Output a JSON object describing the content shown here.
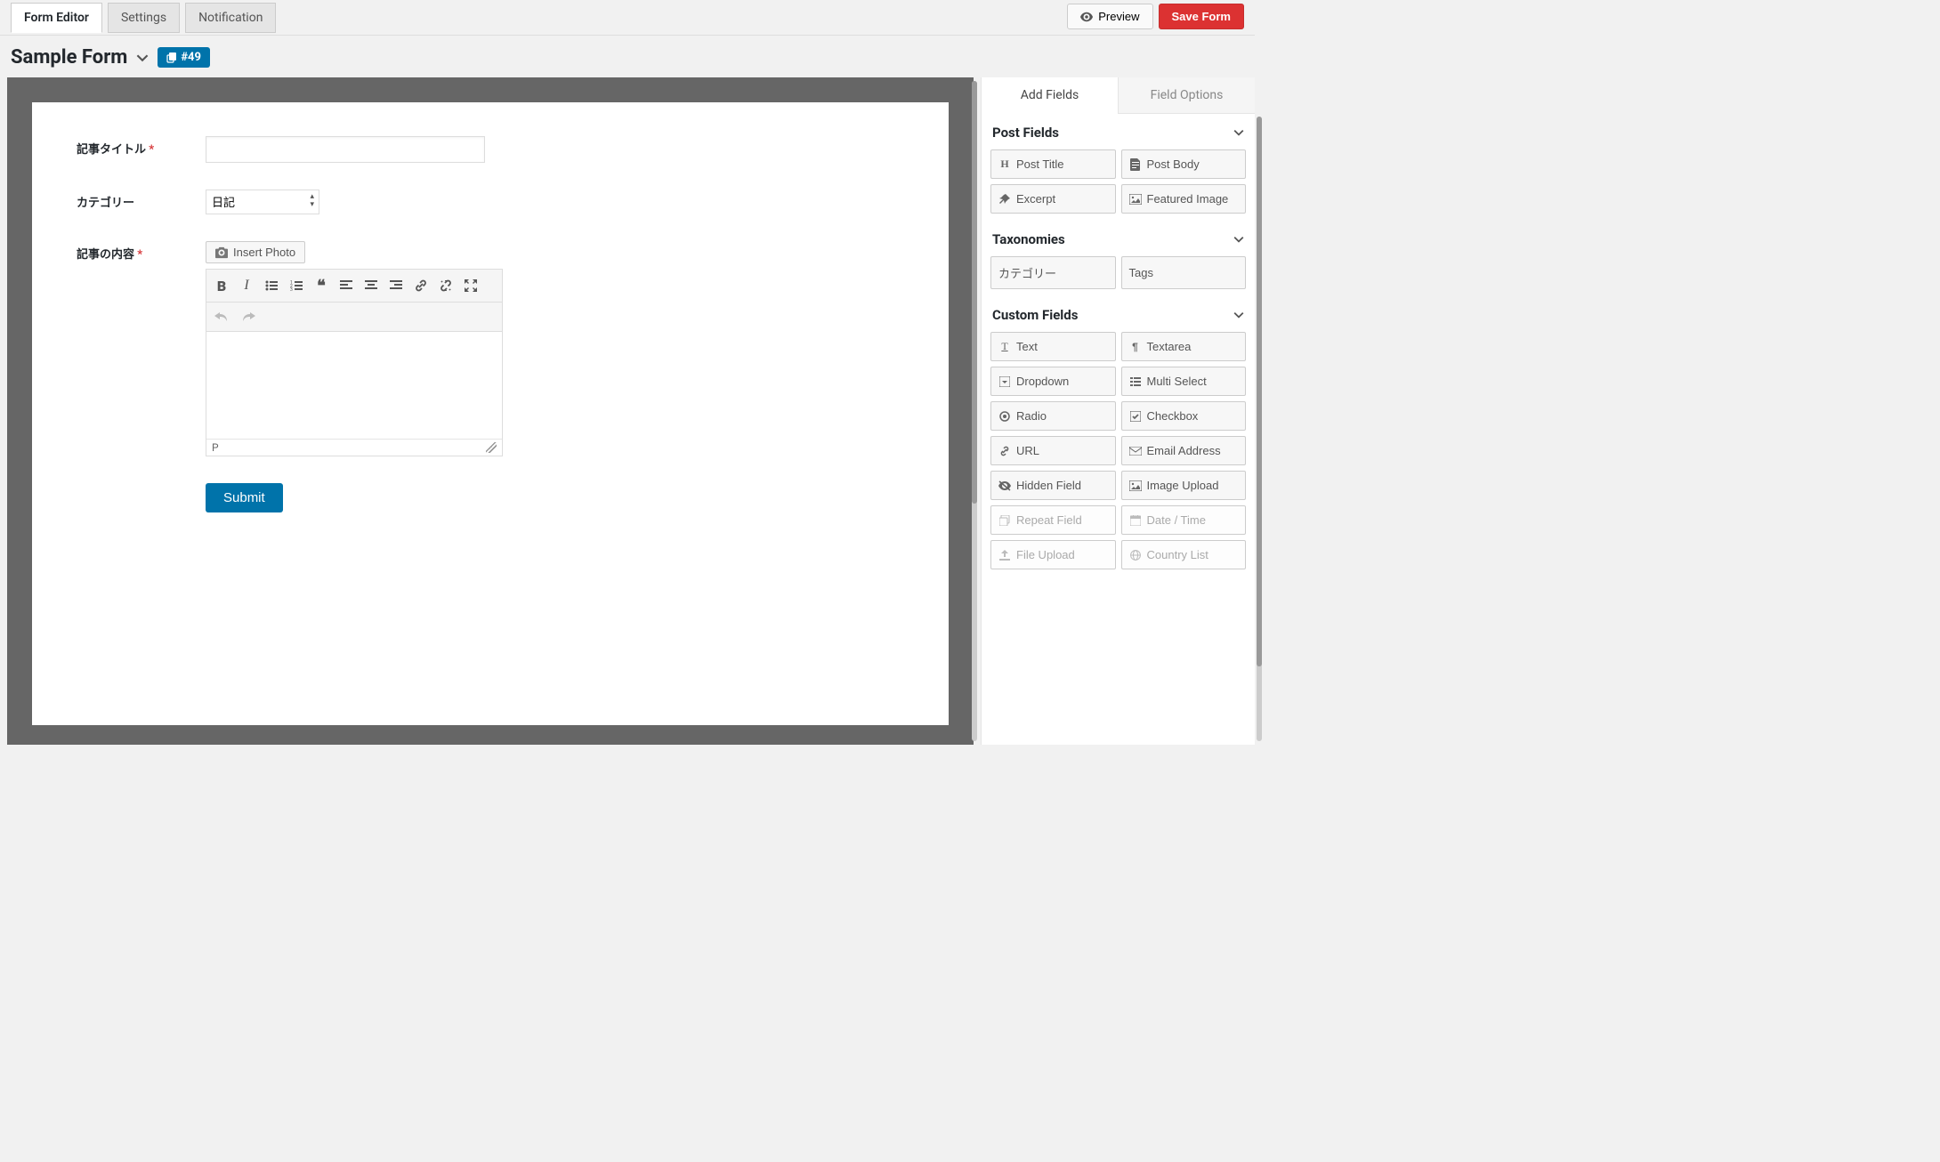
{
  "header": {
    "tabs": [
      "Form Editor",
      "Settings",
      "Notification"
    ],
    "preview_label": "Preview",
    "save_label": "Save Form"
  },
  "subheader": {
    "form_name": "Sample Form",
    "id_pill": "#49"
  },
  "form": {
    "title_label": "記事タイトル",
    "category_label": "カテゴリー",
    "category_value": "日記",
    "content_label": "記事の内容",
    "insert_photo_label": "Insert Photo",
    "editor_status": "P",
    "submit_label": "Submit"
  },
  "sidebar": {
    "tabs": [
      "Add Fields",
      "Field Options"
    ],
    "sections": {
      "post_fields": {
        "title": "Post Fields",
        "items": [
          "Post Title",
          "Post Body",
          "Excerpt",
          "Featured Image"
        ]
      },
      "taxonomies": {
        "title": "Taxonomies",
        "items": [
          "カテゴリー",
          "Tags"
        ]
      },
      "custom_fields": {
        "title": "Custom Fields",
        "items": [
          "Text",
          "Textarea",
          "Dropdown",
          "Multi Select",
          "Radio",
          "Checkbox",
          "URL",
          "Email Address",
          "Hidden Field",
          "Image Upload",
          "Repeat Field",
          "Date / Time",
          "File Upload",
          "Country List"
        ]
      }
    }
  }
}
